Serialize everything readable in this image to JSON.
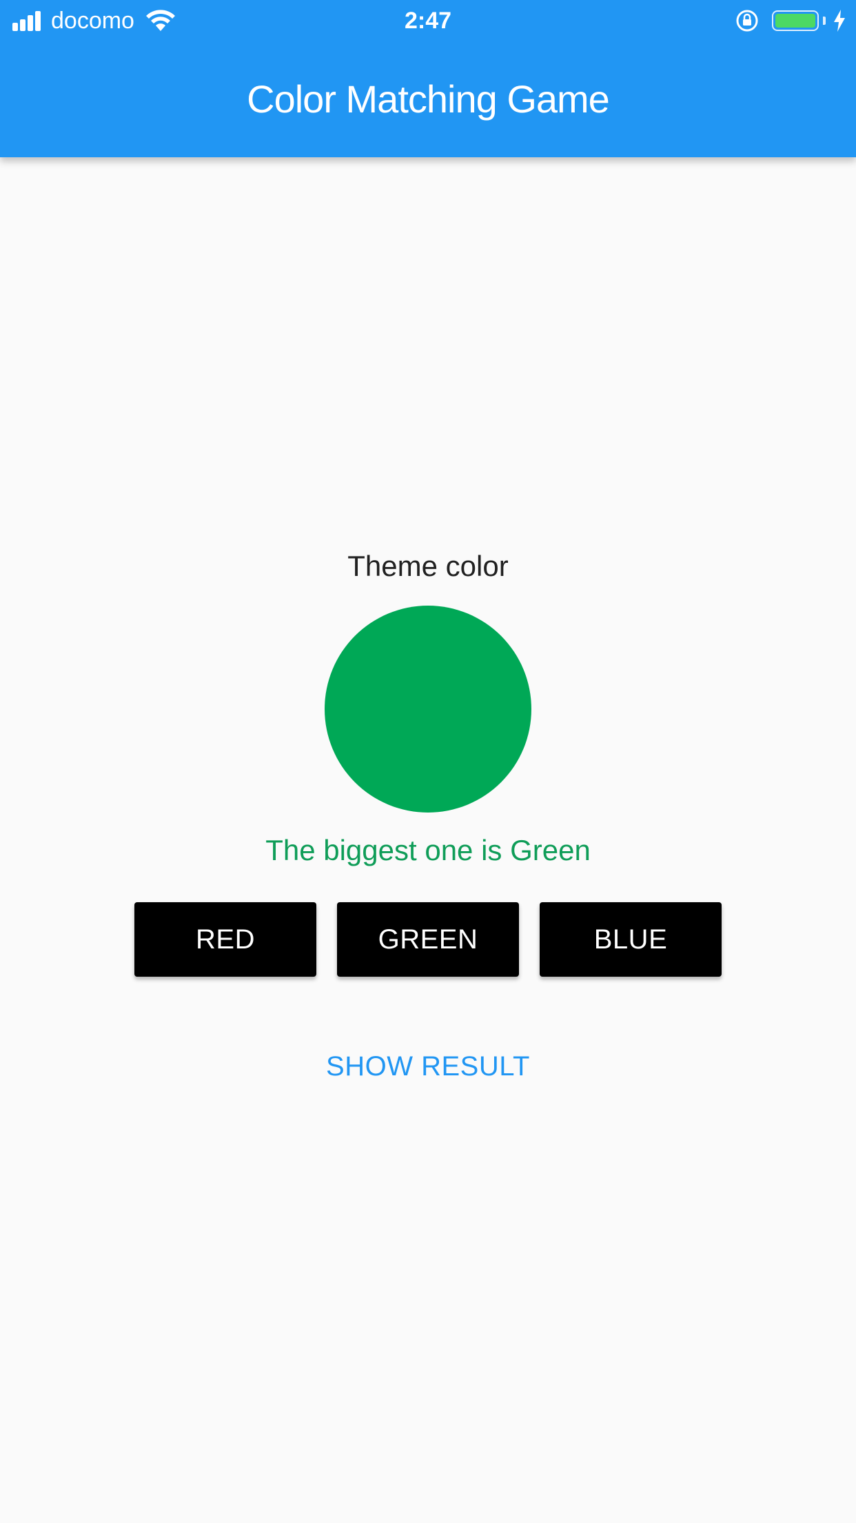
{
  "status_bar": {
    "carrier": "docomo",
    "time": "2:47",
    "signal_icon": "signal-bars-icon",
    "wifi_icon": "wifi-icon",
    "rotation_lock_icon": "rotation-lock-icon",
    "battery_icon": "battery-icon",
    "charging_icon": "charging-bolt-icon",
    "battery_level": 1.0
  },
  "app_bar": {
    "title": "Color Matching Game",
    "background_color": "#2196f3"
  },
  "main": {
    "theme_label": "Theme color",
    "theme_color": "#00a856",
    "result_message": "The biggest one is Green",
    "result_color": "#0f9d58",
    "buttons": [
      {
        "label": "RED"
      },
      {
        "label": "GREEN"
      },
      {
        "label": "BLUE"
      }
    ],
    "show_result_label": "SHOW RESULT",
    "accent_color": "#2196f3"
  }
}
